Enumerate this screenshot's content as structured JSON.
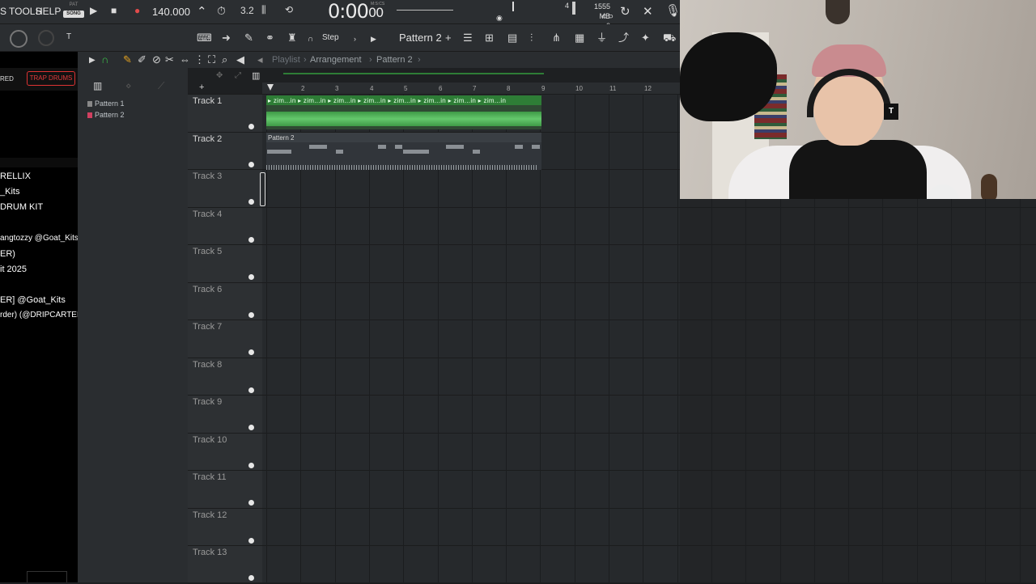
{
  "menu": {
    "tools": "TOOLS",
    "help": "HELP",
    "prefix": "S"
  },
  "transport": {
    "pat": "PAT",
    "song": "SONG",
    "tempo": "140.000",
    "time": "0:00",
    "time_cs": "00",
    "time_label": "M:S:CS",
    "step_label": "3.2"
  },
  "system": {
    "memory": "1555 MB",
    "cpu_count": "4",
    "cpu_zero": "0"
  },
  "toolbar2": {
    "step": "Step",
    "pattern": "Pattern 2",
    "plus": "+"
  },
  "breadcrumb": {
    "playlist": "Playlist",
    "arrangement": "Arrangement",
    "pattern": "Pattern 2"
  },
  "browser": {
    "tag_red": "RED",
    "tag_trap": "TRAP DRUMS",
    "items": [
      "RELLIX",
      "_Kits",
      "DRUM KIT",
      "angtozzy @Goat_Kits",
      "ER)",
      "it 2025",
      "ER] @Goat_Kits",
      "rder) (@DRIPCARTEL)"
    ]
  },
  "picker": {
    "items": [
      "Pattern 1",
      "Pattern 2"
    ]
  },
  "ruler": [
    "2",
    "3",
    "4",
    "5",
    "6",
    "7",
    "8",
    "9",
    "10",
    "11",
    "12"
  ],
  "tracks": [
    "Track 1",
    "Track 2",
    "Track 3",
    "Track 4",
    "Track 5",
    "Track 6",
    "Track 7",
    "Track 8",
    "Track 9",
    "Track 10",
    "Track 11",
    "Track 12",
    "Track 13"
  ],
  "clips": {
    "audio_label": "▸ zim...in ▸ zim...in ▸ zim...in ▸ zim...in ▸ zim...in ▸ zim...in ▸ zim...in ▸ zim...in",
    "pattern_label": "Pattern 2"
  },
  "colors": {
    "accent_green": "#2e7d36",
    "trap_red": "#e03a3a"
  }
}
